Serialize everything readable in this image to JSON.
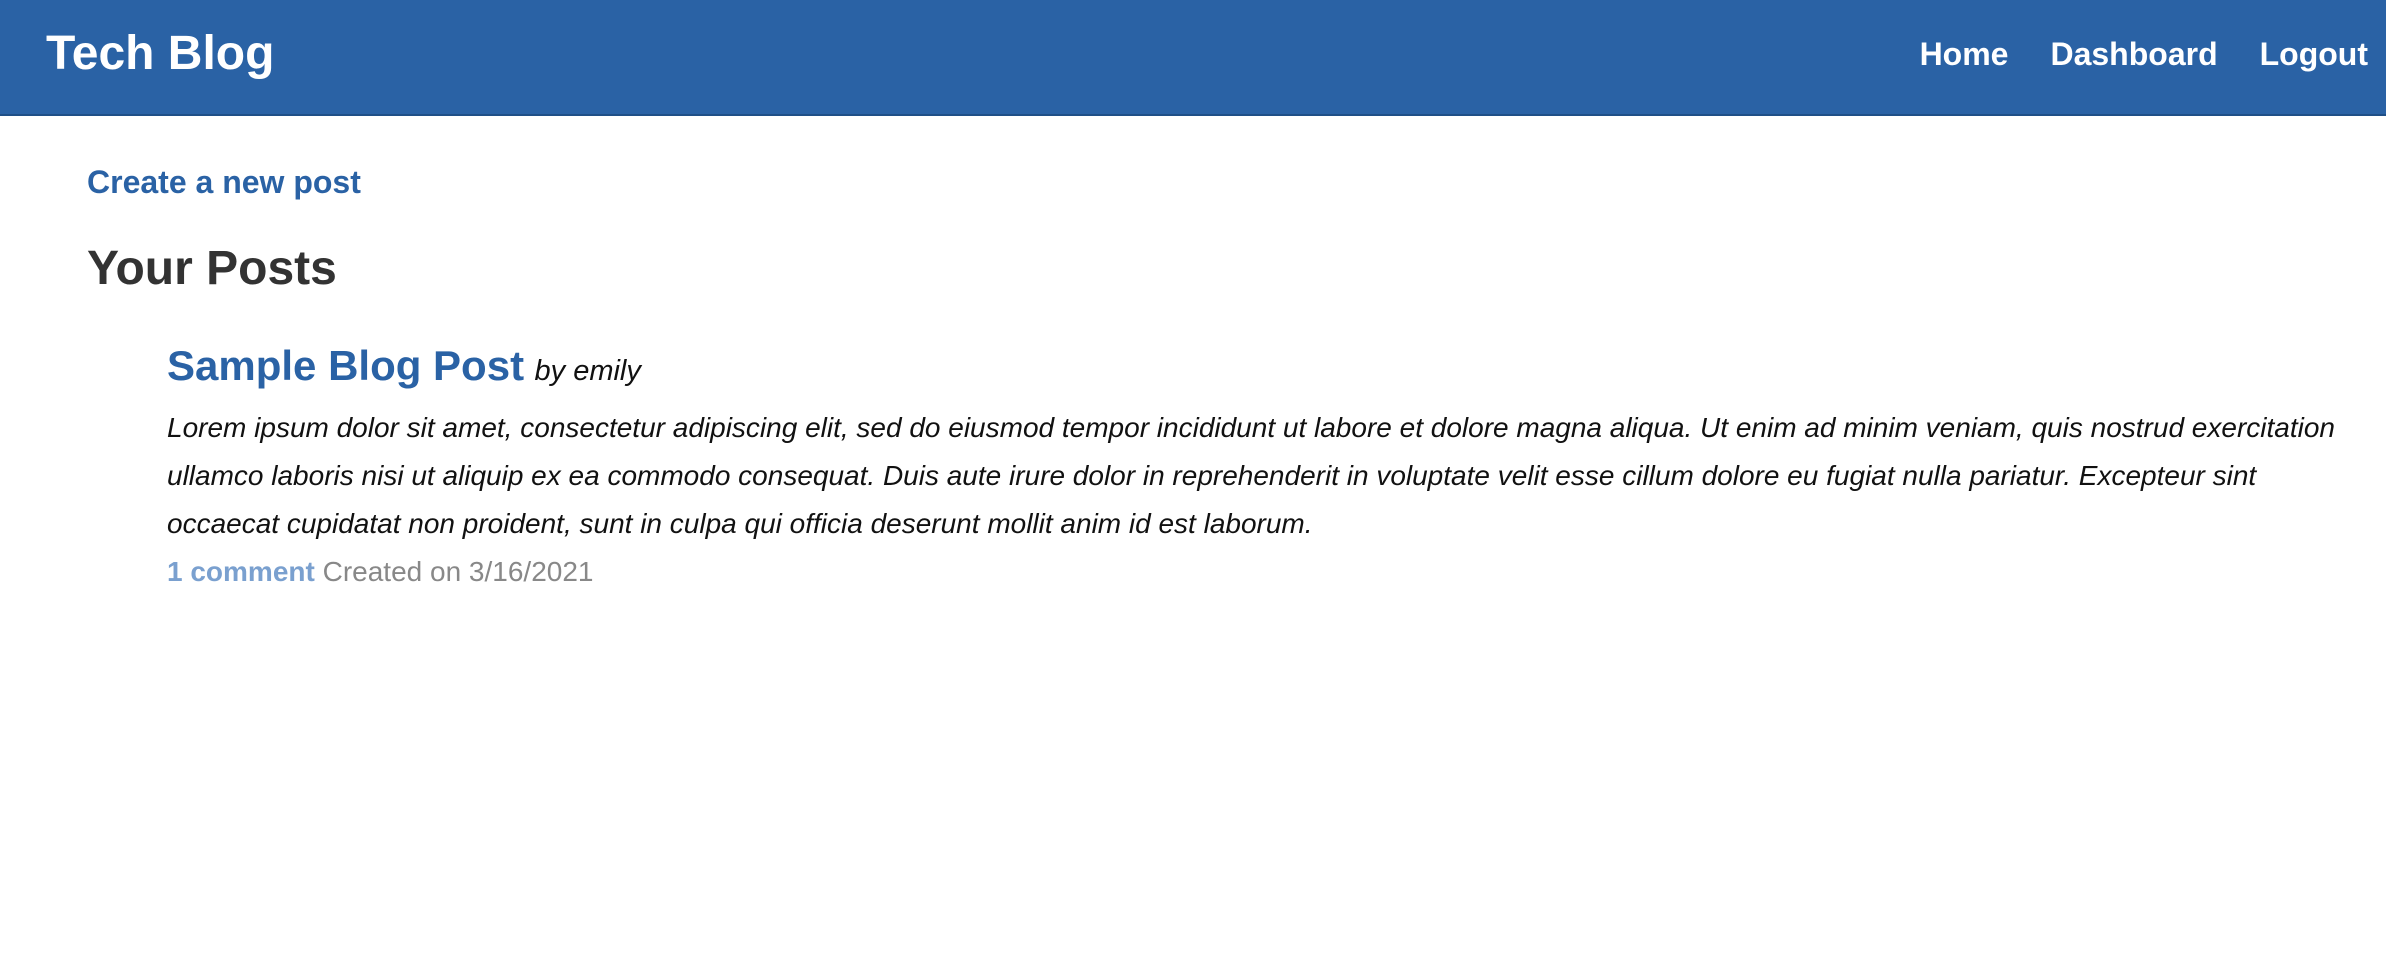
{
  "header": {
    "brand": "Tech Blog",
    "nav": {
      "home": "Home",
      "dashboard": "Dashboard",
      "logout": "Logout"
    },
    "background_color": "#2a62a5"
  },
  "main": {
    "create_link": "Create a new post",
    "section_title": "Your Posts",
    "posts": [
      {
        "title": "Sample Blog Post",
        "author": "by emily",
        "body": "Lorem ipsum dolor sit amet, consectetur adipiscing elit, sed do eiusmod tempor incididunt ut labore et dolore magna aliqua. Ut enim ad minim veniam, quis nostrud exercitation ullamco laboris nisi ut aliquip ex ea commodo consequat. Duis aute irure dolor in reprehenderit in voluptate velit esse cillum dolore eu fugiat nulla pariatur. Excepteur sint occaecat cupidatat non proident, sunt in culpa qui officia deserunt mollit anim id est laborum.",
        "comments": "1 comment",
        "created": "Created on 3/16/2021"
      }
    ]
  }
}
